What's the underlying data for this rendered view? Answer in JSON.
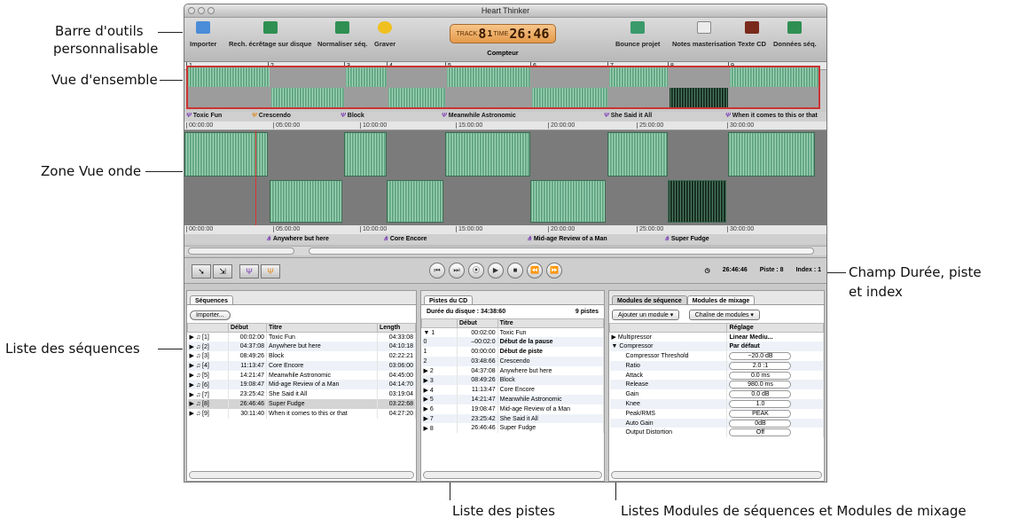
{
  "callouts": {
    "toolbar": "Barre d'outils",
    "toolbar2": "personnalisable",
    "overview": "Vue d'ensemble",
    "wave_zone": "Zone Vue onde",
    "duration": "Champ Durée, piste",
    "duration2": "et index",
    "sequences_list": "Liste des séquences",
    "tracks_list": "Liste des pistes",
    "modules_list": "Listes Modules de séquences et Modules de mixage"
  },
  "window": {
    "title": "Heart Thinker"
  },
  "toolbar": {
    "items": [
      {
        "label": "Importer",
        "icon": "import-icon"
      },
      {
        "label": "Rech. écrêtage sur disque",
        "icon": "clip-scan-icon"
      },
      {
        "label": "Normaliser séq.",
        "icon": "normalize-icon"
      },
      {
        "label": "Graver",
        "icon": "burn-icon"
      },
      {
        "label": "Bounce projet",
        "icon": "bounce-icon"
      },
      {
        "label": "Notes masterisation",
        "icon": "notes-icon"
      },
      {
        "label": "Texte CD",
        "icon": "cd-text-icon"
      },
      {
        "label": "Données séq.",
        "icon": "info-icon"
      }
    ],
    "counter": {
      "track_label": "TRACK",
      "track": "8",
      "index": "1",
      "time_label": "TIME",
      "time": "26:46",
      "label": "Compteur"
    }
  },
  "overview_ruler": [
    "1",
    "2",
    "3",
    "4",
    "5",
    "6",
    "7",
    "8",
    "9"
  ],
  "markers_top": [
    "Toxic Fun",
    "Crescendo",
    "Block",
    "Meanwhile Astronomic",
    "She Said it All",
    "When it comes to this or that"
  ],
  "markers_bottom": [
    "Anywhere but here",
    "Core Encore",
    "Mid-age Review of a Man",
    "Super Fudge"
  ],
  "time_ruler_top": [
    "00:00:00",
    "05:00:00",
    "10:00:00",
    "15:00:00",
    "20:00:00",
    "25:00:00",
    "30:00:00"
  ],
  "time_ruler_bottom": [
    "00:00:00",
    "05:00:00",
    "10:00:00",
    "15:00:00",
    "20:00:00",
    "25:00:00",
    "30:00:00"
  ],
  "transport": {
    "buttons": [
      "⏮",
      "⏭",
      "⦿",
      "▶",
      "■",
      "⏪",
      "⏩"
    ],
    "time": "26:46:46",
    "track": "Piste : 8",
    "index": "Index : 1"
  },
  "sequences_pane": {
    "tab": "Séquences",
    "import_button": "Importer...",
    "headers": [
      "",
      "Début",
      "Titre",
      "Length"
    ],
    "rows": [
      [
        "[1]",
        "00:02:00",
        "Toxic Fun",
        "04:33:08"
      ],
      [
        "[2]",
        "04:37:08",
        "Anywhere but here",
        "04:10:18"
      ],
      [
        "[3]",
        "08:49:26",
        "Block",
        "02:22:21"
      ],
      [
        "[4]",
        "11:13:47",
        "Core Encore",
        "03:06:00"
      ],
      [
        "[5]",
        "14:21:47",
        "Meanwhile Astronomic",
        "04:45:00"
      ],
      [
        "[6]",
        "19:08:47",
        "Mid-age Review of a Man",
        "04:14:70"
      ],
      [
        "[7]",
        "23:25:42",
        "She Said it All",
        "03:19:04"
      ],
      [
        "[8]",
        "26:46:46",
        "Super Fudge",
        "03:22:68"
      ],
      [
        "[9]",
        "30:11:40",
        "When it comes to this or that",
        "04:27:20"
      ]
    ]
  },
  "tracks_pane": {
    "tab": "Pistes du CD",
    "duration": "Durée du disque : 34:38:60",
    "count": "9 pistes",
    "headers": [
      "",
      "Début",
      "Titre"
    ],
    "rows": [
      [
        "▼ 1",
        "00:02:00",
        "Toxic Fun"
      ],
      [
        "   0",
        "–00:02:0",
        "Début de la pause"
      ],
      [
        "   1",
        "00:00:00",
        "Début de piste"
      ],
      [
        "   2",
        "03:48:66",
        "Crescendo"
      ],
      [
        "▶ 2",
        "04:37:08",
        "Anywhere but here"
      ],
      [
        "▶ 3",
        "08:49:26",
        "Block"
      ],
      [
        "▶ 4",
        "11:13:47",
        "Core Encore"
      ],
      [
        "▶ 5",
        "14:21:47",
        "Meanwhile Astronomic"
      ],
      [
        "▶ 6",
        "19:08:47",
        "Mid-age Review of a Man"
      ],
      [
        "▶ 7",
        "23:25:42",
        "She Said it All"
      ],
      [
        "▶ 8",
        "26:46:46",
        "Super Fudge"
      ]
    ]
  },
  "modules_pane": {
    "tabs": [
      "Modules de séquence",
      "Modules de mixage"
    ],
    "add_button": "Ajouter un module",
    "chain_button": "Chaîne de modules",
    "setting_header": "Réglage",
    "rows": [
      [
        "▶ Multipressor",
        "Linear Mediu..."
      ],
      [
        "▼ Compressor",
        "Par défaut"
      ],
      [
        "Compressor Threshold",
        "−20.0 dB"
      ],
      [
        "Ratio",
        "2.0 :1"
      ],
      [
        "Attack",
        "0.0 ms"
      ],
      [
        "Release",
        "980.0 ms"
      ],
      [
        "Gain",
        "0.0 dB"
      ],
      [
        "Knee",
        "1.0"
      ],
      [
        "Peak/RMS",
        "PEAK"
      ],
      [
        "Auto Gain",
        "0dB"
      ],
      [
        "Output Distortion",
        "Off"
      ]
    ]
  }
}
